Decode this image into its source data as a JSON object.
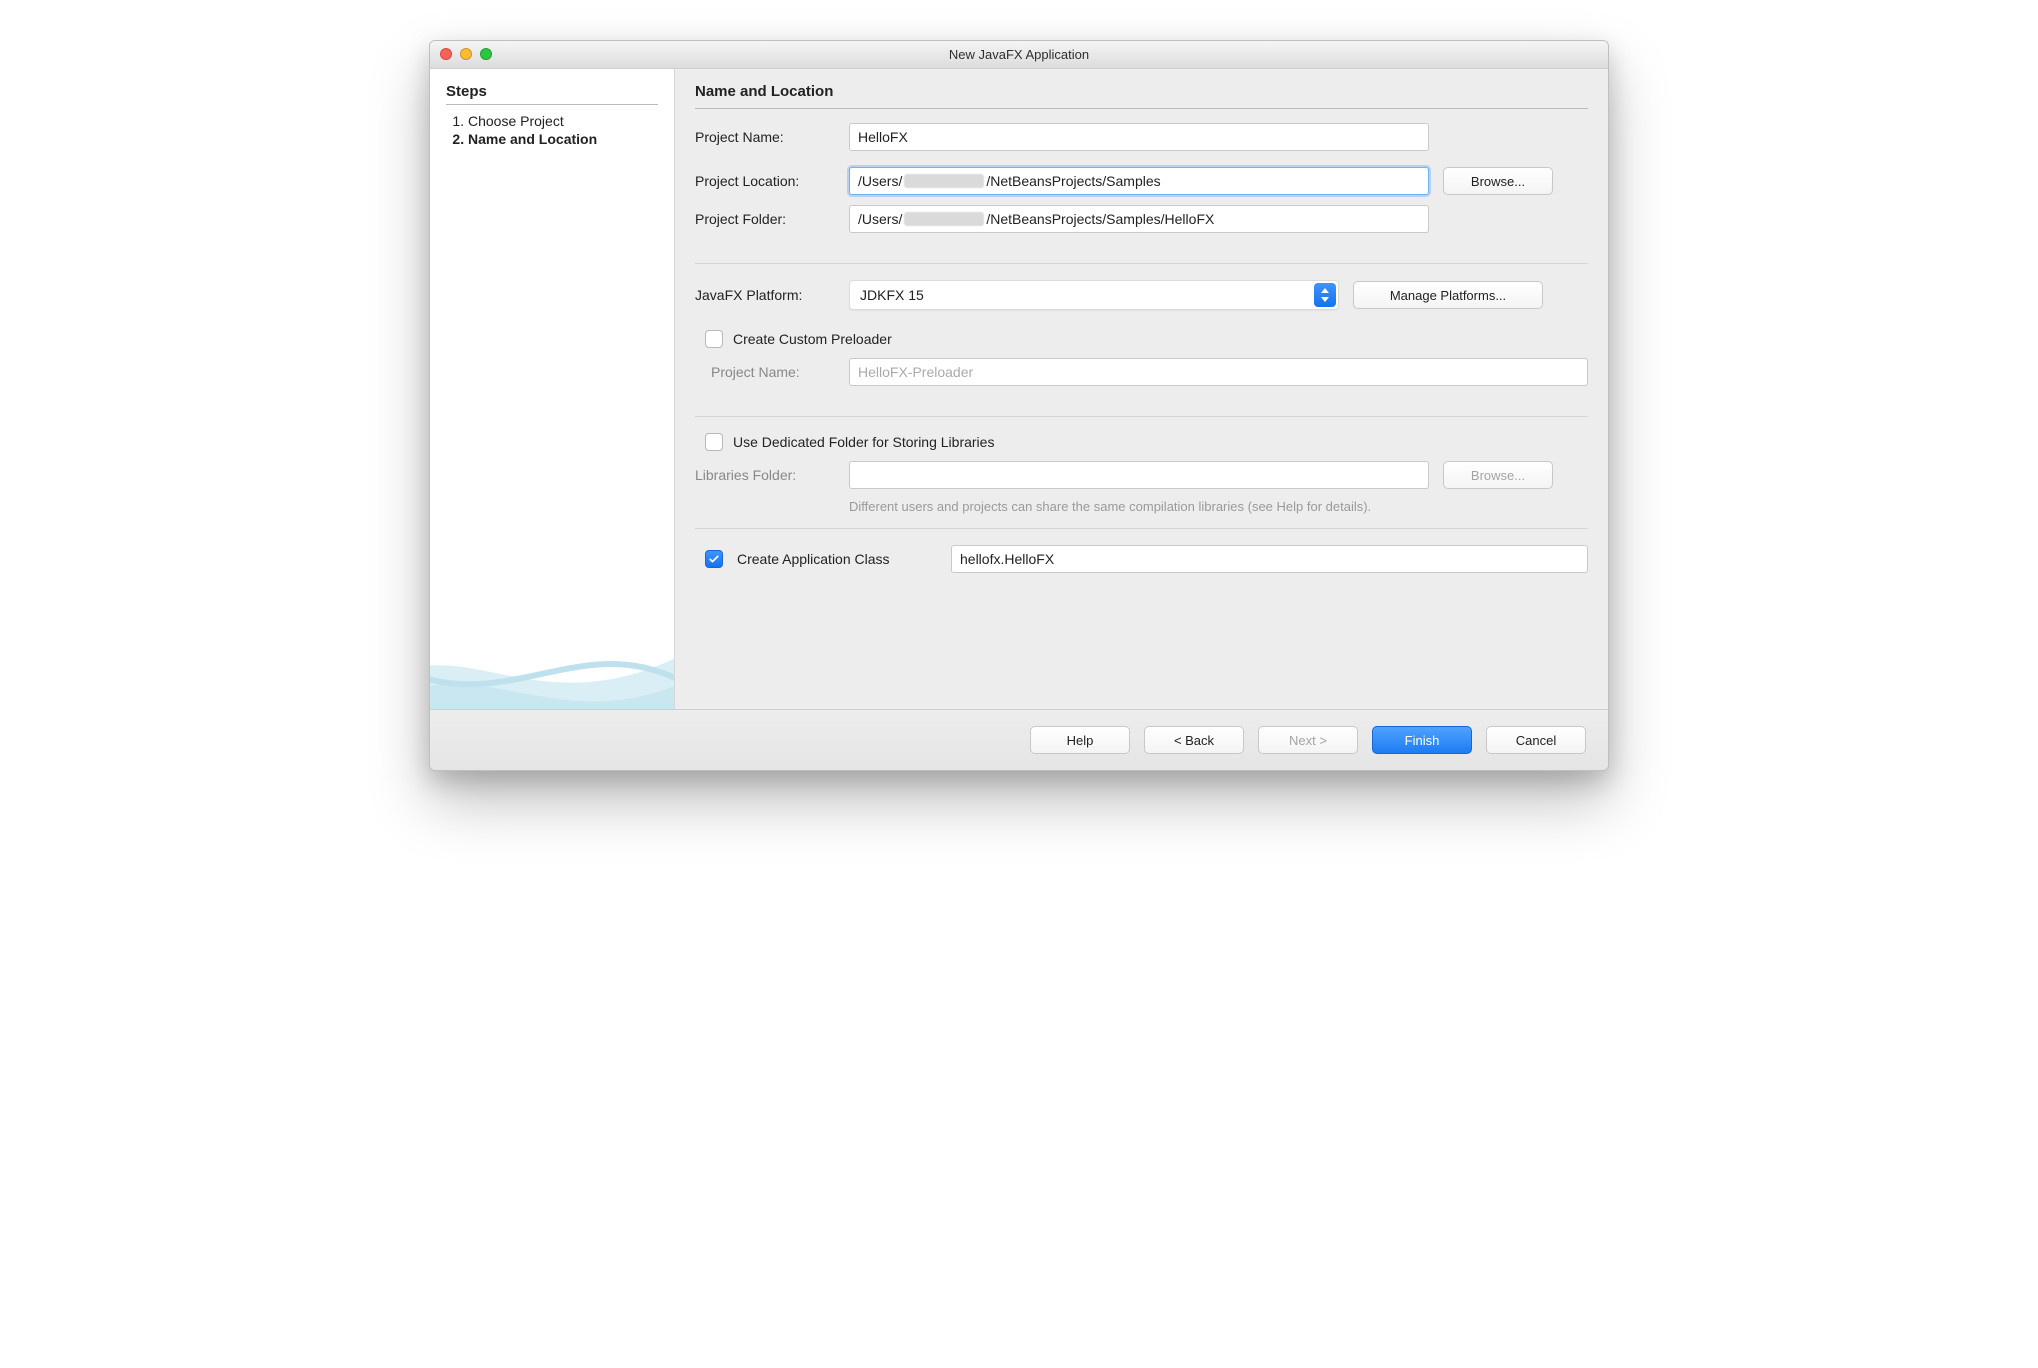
{
  "window": {
    "title": "New JavaFX Application"
  },
  "sidebar": {
    "heading": "Steps",
    "steps": [
      "Choose Project",
      "Name and Location"
    ],
    "activeIndex": 1
  },
  "main": {
    "heading": "Name and Location",
    "projectName": {
      "label": "Project Name:",
      "value": "HelloFX"
    },
    "projectLocation": {
      "label": "Project Location:",
      "prefix": "/Users/",
      "suffix": "/NetBeansProjects/Samples",
      "browse": "Browse..."
    },
    "projectFolder": {
      "label": "Project Folder:",
      "prefix": "/Users/",
      "suffix": "/NetBeansProjects/Samples/HelloFX"
    },
    "platform": {
      "label": "JavaFX Platform:",
      "value": "JDKFX 15",
      "manage": "Manage Platforms..."
    },
    "preloader": {
      "checkLabel": "Create Custom Preloader",
      "checked": false,
      "nameLabel": "Project Name:",
      "nameValue": "HelloFX-Preloader"
    },
    "libFolder": {
      "checkLabel": "Use Dedicated Folder for Storing Libraries",
      "checked": false,
      "label": "Libraries Folder:",
      "value": "",
      "browse": "Browse...",
      "hint": "Different users and projects can share the same compilation libraries (see Help for details)."
    },
    "appClass": {
      "checkLabel": "Create Application Class",
      "checked": true,
      "value": "hellofx.HelloFX"
    }
  },
  "footer": {
    "help": "Help",
    "back": "< Back",
    "next": "Next >",
    "finish": "Finish",
    "cancel": "Cancel"
  }
}
